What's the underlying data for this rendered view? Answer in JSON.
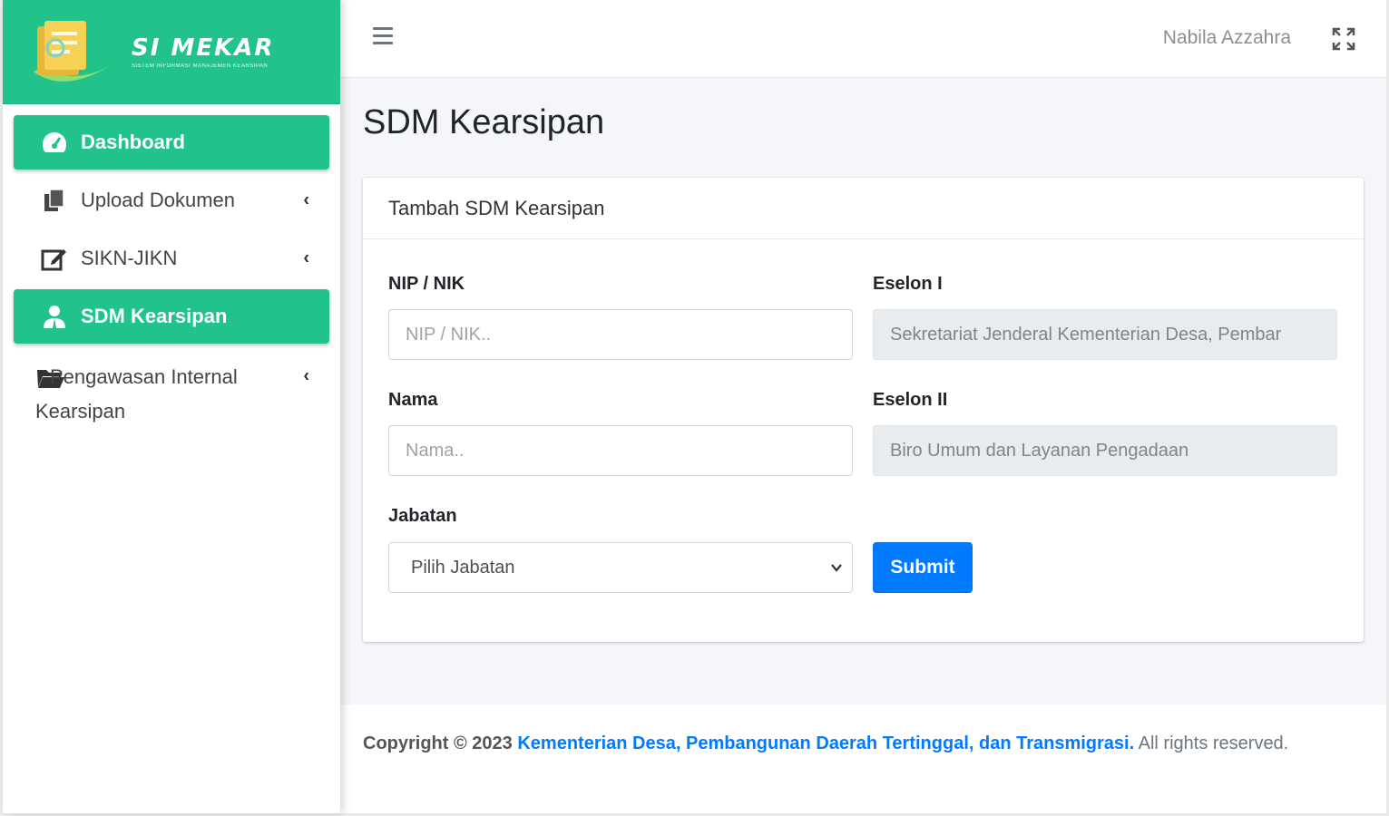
{
  "brand": {
    "name": "SI MEKAR",
    "subtitle": "SISTEM INFORMASI MANAJEMEN KEARSIPAN",
    "color": "#21c38b"
  },
  "sidebar": {
    "items": [
      {
        "label": "Dashboard",
        "icon": "speedometer-icon",
        "active": true,
        "has_children": false
      },
      {
        "label": "Upload Dokumen",
        "icon": "copy-documents-icon",
        "active": false,
        "has_children": true
      },
      {
        "label": "SIKN-JIKN",
        "icon": "edit-square-icon",
        "active": false,
        "has_children": true
      },
      {
        "label": "SDM Kearsipan",
        "icon": "user-tie-icon",
        "active": true,
        "has_children": false
      },
      {
        "label": "Pengawasan Internal Kearsipan",
        "icon": "folder-open-icon",
        "active": false,
        "has_children": true
      }
    ]
  },
  "topbar": {
    "menu_icon": "hamburger-icon",
    "username": "Nabila Azzahra",
    "fullscreen_icon": "expand-icon"
  },
  "page": {
    "title": "SDM Kearsipan"
  },
  "form": {
    "header": "Tambah SDM Kearsipan",
    "nip": {
      "label": "NIP / NIK",
      "placeholder": "NIP / NIK..",
      "value": ""
    },
    "nama": {
      "label": "Nama",
      "placeholder": "Nama..",
      "value": ""
    },
    "jabatan": {
      "label": "Jabatan",
      "selected": "Pilih Jabatan"
    },
    "eselon1": {
      "label": "Eselon I",
      "value": "Sekretariat Jenderal Kementerian Desa, Pembar"
    },
    "eselon2": {
      "label": "Eselon II",
      "value": "Biro Umum dan Layanan Pengadaan"
    },
    "submit_label": "Submit",
    "submit_color": "#007bff"
  },
  "footer": {
    "prefix": "Copyright © 2023",
    "link_text": "Kementerian Desa, Pembangunan Daerah Tertinggal, dan Transmigrasi.",
    "suffix": "All rights reserved."
  }
}
